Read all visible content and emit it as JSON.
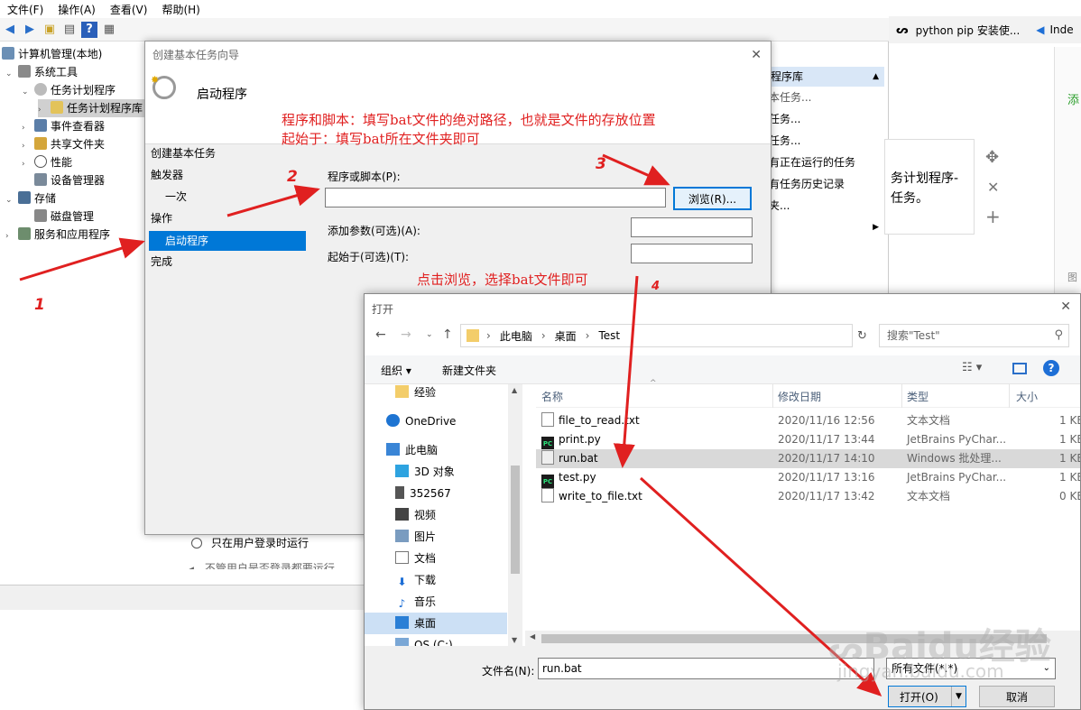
{
  "mmc": {
    "menu": [
      "文件(F)",
      "操作(A)",
      "查看(V)",
      "帮助(H)"
    ],
    "tree": [
      {
        "label": "计算机管理(本地)"
      },
      {
        "label": "系统工具"
      },
      {
        "label": "任务计划程序"
      },
      {
        "label": "任务计划程序库"
      },
      {
        "label": "事件查看器"
      },
      {
        "label": "共享文件夹"
      },
      {
        "label": "性能"
      },
      {
        "label": "设备管理器"
      },
      {
        "label": "存储"
      },
      {
        "label": "磁盘管理"
      },
      {
        "label": "服务和应用程序"
      }
    ],
    "actions_header": "程序库",
    "actions": [
      "本任务...",
      "任务...",
      "任务...",
      "有正在运行的任务",
      "有任务历史记录",
      "夹..."
    ],
    "bottom_radio1": "只在用户登录时运行",
    "bottom_radio2": "不管用户是否登录都要运行"
  },
  "browser": {
    "tab1": "python pip 安装使...",
    "tab2": "Inde",
    "card_line1": "务计划程序-",
    "card_line2": "任务。",
    "side_text1": "添",
    "side_text2": "图"
  },
  "wizard": {
    "title": "创建基本任务向导",
    "header": "启动程序",
    "steps": [
      "创建基本任务",
      "触发器",
      "一次",
      "操作",
      "启动程序",
      "完成"
    ],
    "program_label": "程序或脚本(P):",
    "program_value": "",
    "browse_button": "浏览(R)...",
    "args_label": "添加参数(可选)(A):",
    "startin_label": "起始于(可选)(T):"
  },
  "open_dialog": {
    "title": "打开",
    "breadcrumb": [
      "此电脑",
      "桌面",
      "Test"
    ],
    "search_placeholder": "搜索\"Test\"",
    "organize": "组织 ▾",
    "new_folder": "新建文件夹",
    "nav": [
      "经验",
      "OneDrive",
      "此电脑",
      "3D 对象",
      "352567",
      "视频",
      "图片",
      "文档",
      "下载",
      "音乐",
      "桌面",
      "OS (C:)"
    ],
    "columns": [
      "名称",
      "修改日期",
      "类型",
      "大小"
    ],
    "files": [
      {
        "name": "file_to_read.txt",
        "date": "2020/11/16 12:56",
        "type": "文本文档",
        "size": "1 KB"
      },
      {
        "name": "print.py",
        "date": "2020/11/17 13:44",
        "type": "JetBrains PyChar...",
        "size": "1 KB"
      },
      {
        "name": "run.bat",
        "date": "2020/11/17 14:10",
        "type": "Windows 批处理...",
        "size": "1 KB"
      },
      {
        "name": "test.py",
        "date": "2020/11/17 13:16",
        "type": "JetBrains PyChar...",
        "size": "1 KB"
      },
      {
        "name": "write_to_file.txt",
        "date": "2020/11/17 13:42",
        "type": "文本文档",
        "size": "0 KB"
      }
    ],
    "filename_label": "文件名(N):",
    "filename_value": "run.bat",
    "filter": "所有文件(*.*)",
    "open_button": "打开(O)",
    "cancel_button": "取消"
  },
  "annotations": {
    "text1": "程序和脚本：填写bat文件的绝对路径，也就是文件的存放位置",
    "text2": "起始于：填写bat所在文件夹即可",
    "text3": "点击浏览，选择bat文件即可",
    "n1": "1",
    "n2": "2",
    "n3": "3",
    "n4": "4"
  },
  "watermark": {
    "brand": "Baidu经验",
    "url": "jingyan.baidu.com"
  }
}
